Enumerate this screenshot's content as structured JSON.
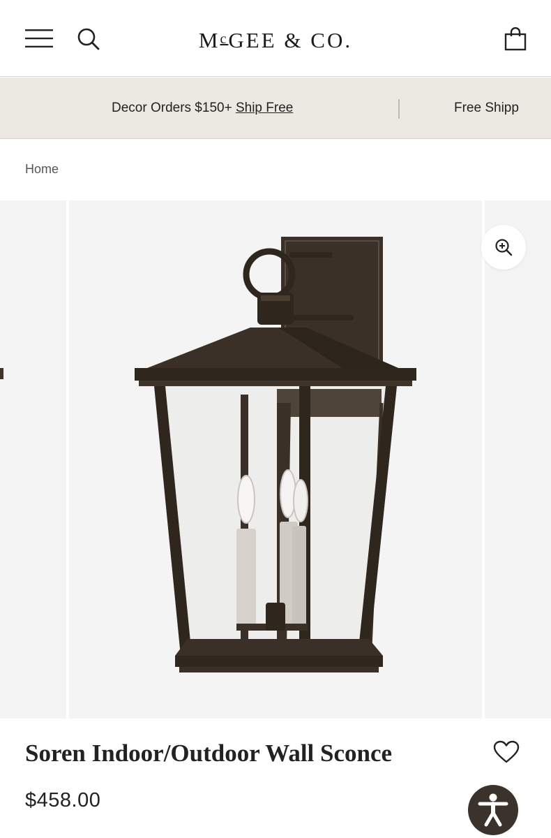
{
  "header": {
    "logo": "McGEE & CO.",
    "menu_icon": "hamburger-menu-icon",
    "search_icon": "search-icon",
    "bag_icon": "shopping-bag-icon"
  },
  "promo": {
    "message_1_text": "Decor Orders $150+ ",
    "message_1_link": "Ship Free",
    "message_2_text": "Free Shipp"
  },
  "breadcrumb": {
    "items": [
      "Home"
    ]
  },
  "gallery": {
    "zoom_icon": "zoom-in-icon",
    "image": "wall-sconce-lantern-image"
  },
  "product": {
    "title": "Soren Indoor/Outdoor Wall Sconce",
    "price": "$458.00",
    "wishlist_icon": "heart-icon"
  },
  "accessibility": {
    "icon": "accessibility-icon"
  },
  "colors": {
    "promo_bg": "#ece8e2",
    "accessibility_bg": "#3b322b",
    "lantern_bronze": "#3a3027"
  }
}
